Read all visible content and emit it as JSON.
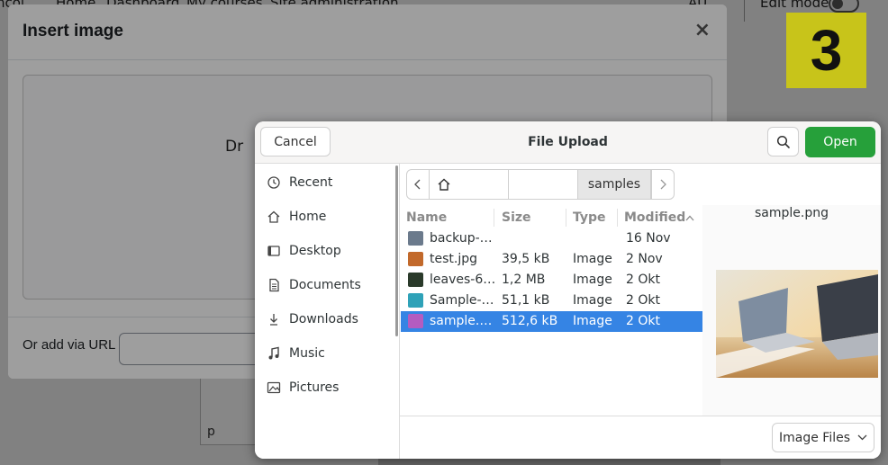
{
  "background": {
    "nav_left": "ncol",
    "nav_items": [
      "Home",
      "Dashboard",
      "My courses",
      "Site administration"
    ],
    "user_initials": "AU",
    "edit_mode_label": "Edit mode",
    "editor_paragraph_tag": "p"
  },
  "badge": {
    "number": "3",
    "color": "#c8c41a"
  },
  "insert_image_modal": {
    "title": "Insert image",
    "close_glyph": "×",
    "drop_text_partial": "Dr",
    "url_label": "Or add via URL",
    "url_value": ""
  },
  "file_chooser": {
    "title": "File Upload",
    "cancel_label": "Cancel",
    "open_label": "Open",
    "search_icon": "search-icon",
    "sidebar": [
      {
        "label": "Recent",
        "icon": "clock-icon"
      },
      {
        "label": "Home",
        "icon": "home-icon"
      },
      {
        "label": "Desktop",
        "icon": "desktop-icon"
      },
      {
        "label": "Documents",
        "icon": "document-icon"
      },
      {
        "label": "Downloads",
        "icon": "download-icon"
      },
      {
        "label": "Music",
        "icon": "music-icon"
      },
      {
        "label": "Pictures",
        "icon": "pictures-icon"
      }
    ],
    "path": {
      "current": "samples"
    },
    "columns": {
      "name": "Name",
      "size": "Size",
      "type": "Type",
      "modified": "Modified"
    },
    "files": [
      {
        "name": "backup-…",
        "size": "",
        "type": "",
        "modified": "16 Nov",
        "icon": "folder-icon",
        "color": "#6b7a8c",
        "selected": false
      },
      {
        "name": "test.jpg",
        "size": "39,5 kB",
        "type": "Image",
        "modified": "2 Nov",
        "icon": "image-thumb-icon",
        "color": "#c2692b",
        "selected": false
      },
      {
        "name": "leaves-6…",
        "size": "1,2 MB",
        "type": "Image",
        "modified": "2 Okt",
        "icon": "image-thumb-icon",
        "color": "#2a3a2a",
        "selected": false
      },
      {
        "name": "Sample-…",
        "size": "51,1 kB",
        "type": "Image",
        "modified": "2 Okt",
        "icon": "image-thumb-icon",
        "color": "#2fa2b8",
        "selected": false
      },
      {
        "name": "sample.…",
        "size": "512,6 kB",
        "type": "Image",
        "modified": "2 Okt",
        "icon": "image-file-icon",
        "color": "#b45cc0",
        "selected": true
      }
    ],
    "preview": {
      "filename": "sample.png"
    },
    "filter_label": "Image Files",
    "accent_color": "#3584e4",
    "open_color": "#26a03a"
  }
}
